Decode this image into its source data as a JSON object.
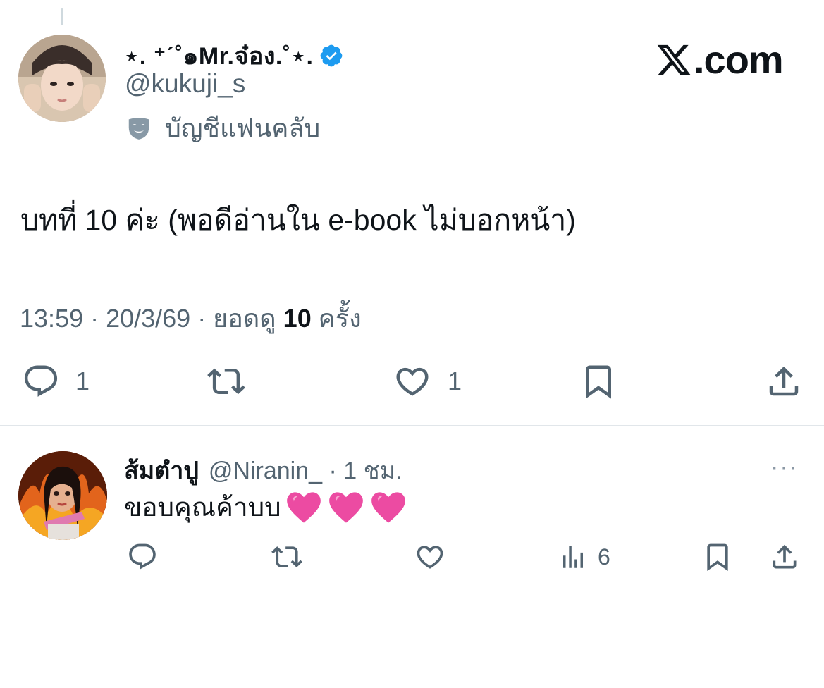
{
  "tweet": {
    "display_name": "⋆. ⁺ˊ˚๑Mr.จ๋อง.˚⋆.",
    "handle": "@kukuji_s",
    "badge_label": "บัญชีแฟนคลับ",
    "site_logo_text": ".com",
    "text": "บทที่ 10 ค่ะ  (พอดีอ่านใน e-book ไม่บอกหน้า)",
    "meta_prefix": "13:59 · 20/3/69 · ยอดดู ",
    "view_count": "10",
    "meta_suffix": " ครั้ง",
    "reply_count": "1",
    "like_count": "1"
  },
  "reply": {
    "display_name": "ส้มตำปู",
    "handle_time": "@Niranin_ · 1 ชม.",
    "text": "ขอบคุณค้าบบ",
    "view_count": "6",
    "more": "···"
  },
  "colors": {
    "verified": "#1d9bf0",
    "secondary_text": "#536471",
    "heart_emoji": "#ec4ba2"
  },
  "icons": [
    "verified-badge-icon",
    "mask-icon",
    "x-logo-icon",
    "reply-icon",
    "retweet-icon",
    "like-icon",
    "bookmark-icon",
    "share-icon",
    "views-icon",
    "heart-emoji-icon"
  ]
}
